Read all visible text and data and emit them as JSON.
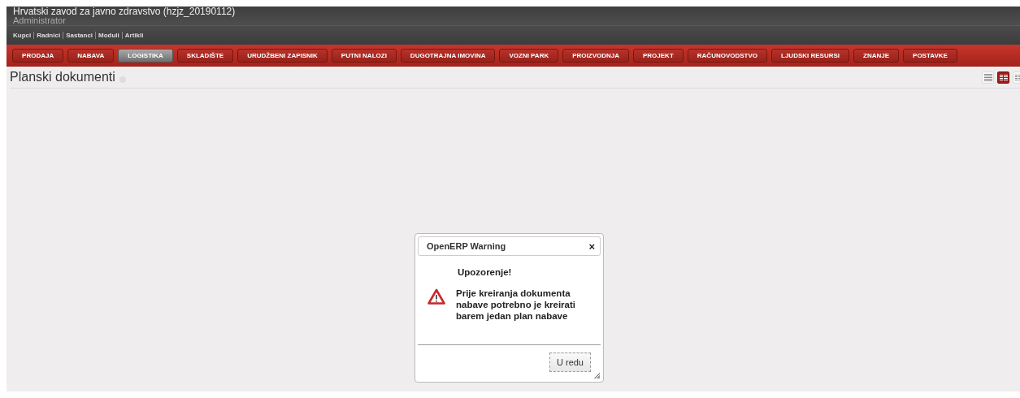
{
  "header": {
    "company": "Hrvatski zavod za javno zdravstvo (hzjz_20190112)",
    "user": "Administrator",
    "shortcuts": [
      "Kupci",
      "Radnici",
      "Sastanci",
      "Moduli",
      "Artikli"
    ]
  },
  "menu": [
    {
      "label": "PRODAJA",
      "selected": false
    },
    {
      "label": "NABAVA",
      "selected": false
    },
    {
      "label": "LOGISTIKA",
      "selected": true
    },
    {
      "label": "SKLADIŠTE",
      "selected": false
    },
    {
      "label": "URUDŽBENI ZAPISNIK",
      "selected": false
    },
    {
      "label": "PUTNI NALOZI",
      "selected": false
    },
    {
      "label": "DUGOTRAJNA IMOVINA",
      "selected": false
    },
    {
      "label": "VOZNI PARK",
      "selected": false
    },
    {
      "label": "PROIZVODNJA",
      "selected": false
    },
    {
      "label": "PROJEKT",
      "selected": false
    },
    {
      "label": "RAČUNOVODSTVO",
      "selected": false
    },
    {
      "label": "LJUDSKI RESURSI",
      "selected": false
    },
    {
      "label": "ZNANJE",
      "selected": false
    },
    {
      "label": "POSTAVKE",
      "selected": false
    }
  ],
  "page": {
    "title": "Planski dokumenti",
    "view_modes": [
      {
        "kind": "list",
        "selected": false
      },
      {
        "kind": "form",
        "selected": true
      },
      {
        "kind": "calendar",
        "selected": false
      }
    ]
  },
  "dialog": {
    "title": "OpenERP Warning",
    "close": "×",
    "heading": "Upozorenje!",
    "message": "Prije kreiranja dokumenta nabave potrebno je kreirati barem jedan plan nabave",
    "button": "U redu"
  }
}
